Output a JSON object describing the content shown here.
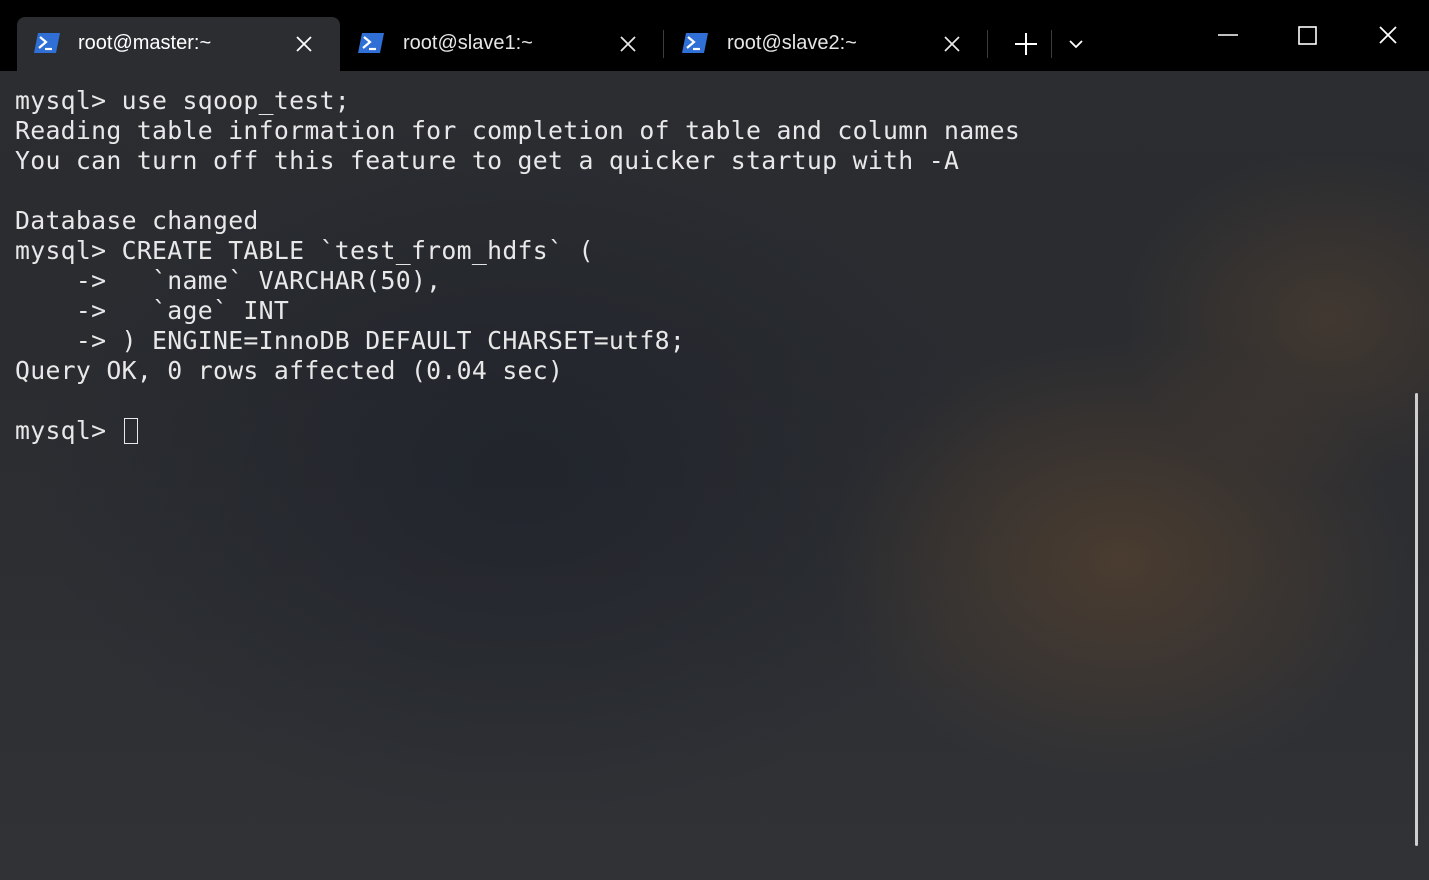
{
  "tabs": [
    {
      "label": "root@master:~",
      "icon": "powershell-icon",
      "active": true
    },
    {
      "label": "root@slave1:~",
      "icon": "powershell-icon",
      "active": false
    },
    {
      "label": "root@slave2:~",
      "icon": "powershell-icon",
      "active": false
    }
  ],
  "titlebar": {
    "new_tab_icon": "plus-icon",
    "dropdown_icon": "chevron-down-icon",
    "minimize_icon": "minimize-icon",
    "maximize_icon": "maximize-icon",
    "close_icon": "close-icon"
  },
  "terminal": {
    "lines": [
      "mysql> use sqoop_test;",
      "Reading table information for completion of table and column names",
      "You can turn off this feature to get a quicker startup with -A",
      "",
      "Database changed",
      "mysql> CREATE TABLE `test_from_hdfs` (",
      "    ->   `name` VARCHAR(50),",
      "    ->   `age` INT",
      "    -> ) ENGINE=InnoDB DEFAULT CHARSET=utf8;",
      "Query OK, 0 rows affected (0.04 sec)",
      "",
      "mysql> "
    ]
  },
  "colors": {
    "titlebar_bg": "#000000",
    "active_tab_bg": "#2b2d31",
    "text": "#e8e8e8",
    "icon_blue": "#2f6fd6"
  }
}
